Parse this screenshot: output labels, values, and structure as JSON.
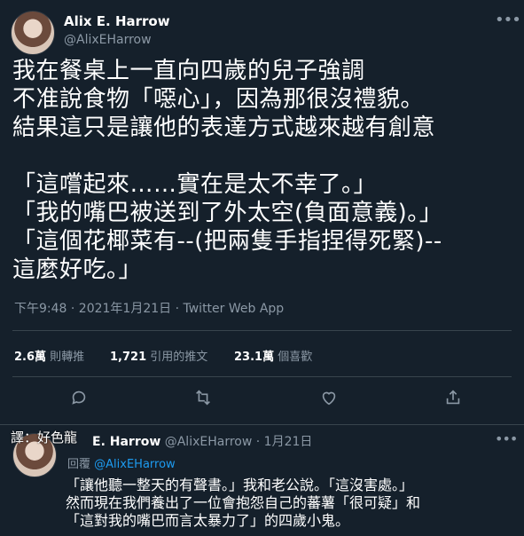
{
  "main_tweet": {
    "author_name": "Alix E. Harrow",
    "author_handle": "@AlixEHarrow",
    "lines": [
      "我在餐桌上一直向四歲的兒子強調",
      "不准說食物「噁心」，因為那很沒禮貌。",
      "結果這只是讓他的表達方式越來越有創意",
      "「這嚐起來……實在是太不幸了。」",
      "「我的嘴巴被送到了外太空(負面意義)。」",
      "「這個花椰菜有--(把兩隻手指捏得死緊)--",
      "這麼好吃。」"
    ],
    "timestamp": "下午9:48 · 2021年1月21日 · Twitter Web App",
    "stats": [
      {
        "count": "2.6萬",
        "label": "則轉推"
      },
      {
        "count": "1,721",
        "label": "引用的推文"
      },
      {
        "count": "23.1萬",
        "label": "個喜歡"
      }
    ],
    "actions": [
      "reply-icon",
      "retweet-icon",
      "like-icon",
      "share-icon"
    ]
  },
  "overlay": {
    "translator": "譯：好色龍"
  },
  "reply": {
    "author_name": "E. Harrow",
    "author_handle": "@AlixEHarrow",
    "date": "· 1月21日",
    "replying_prefix": "回覆",
    "replying_to": "@AlixEHarrow",
    "lines": [
      "「讓他聽一整天的有聲書。」我和老公說。「這沒害處。」",
      "然而現在我們養出了一位會抱怨自己的蕃薯「很可疑」和",
      "「這對我的嘴巴而言太暴力了」的四歲小鬼。"
    ]
  },
  "colors": {
    "background": "#15202b",
    "muted": "#8b98a5",
    "link": "#1d9bf0",
    "divider": "#38444d"
  }
}
